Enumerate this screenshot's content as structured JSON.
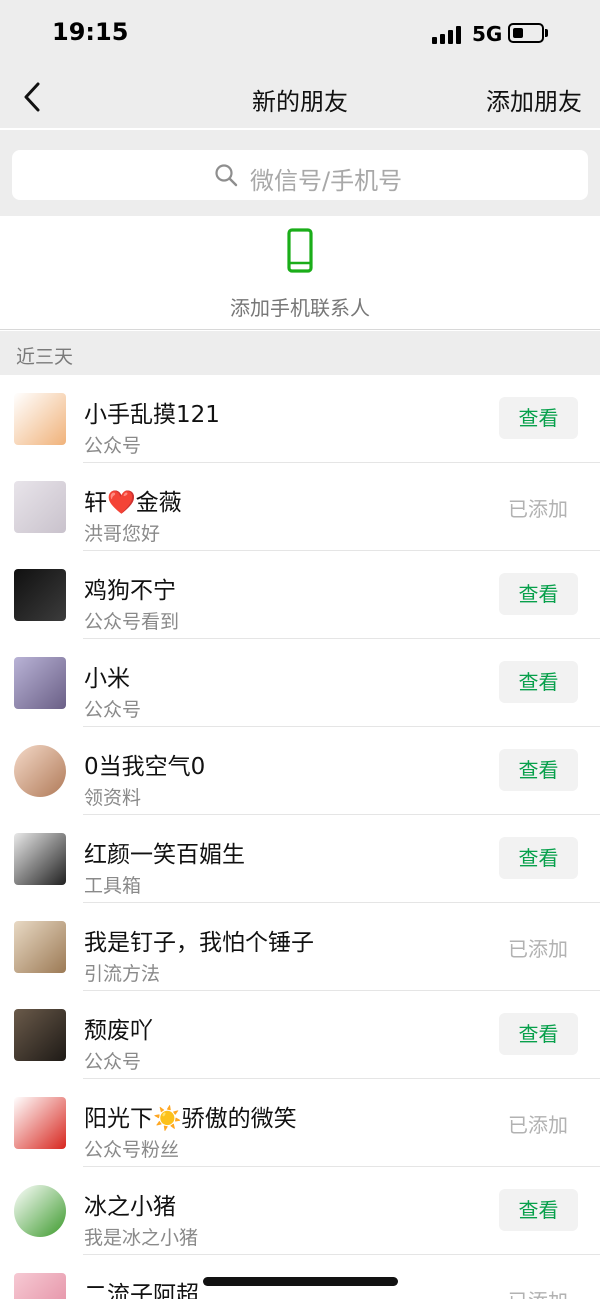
{
  "status_bar": {
    "time": "19:15",
    "network": "5G",
    "battery_level": 0.35
  },
  "nav": {
    "title": "新的朋友",
    "action": "添加朋友"
  },
  "search": {
    "placeholder": "微信号/手机号"
  },
  "add_contacts": {
    "label": "添加手机联系人"
  },
  "section": {
    "label": "近三天"
  },
  "labels": {
    "view": "查看",
    "added": "已添加"
  },
  "colors": {
    "accent_green": "#07a04b",
    "header_bg": "#ededed",
    "phone_icon": "#1aad19"
  },
  "friends": [
    {
      "name": "小手乱摸121",
      "message": "公众号",
      "status": "view",
      "avatar_colors": [
        "#ffffff",
        "#f0b27a"
      ]
    },
    {
      "name": "轩❤️金薇",
      "message": "洪哥您好",
      "status": "added",
      "avatar_colors": [
        "#e8e4ea",
        "#c9c2cc"
      ]
    },
    {
      "name": "鸡狗不宁",
      "message": "公众号看到",
      "status": "view",
      "avatar_colors": [
        "#101010",
        "#3c3c3c"
      ]
    },
    {
      "name": "小米",
      "message": "公众号",
      "status": "view",
      "avatar_colors": [
        "#b9b3d6",
        "#6a5f86"
      ]
    },
    {
      "name": "0当我空气0",
      "message": "领资料",
      "status": "view",
      "avatar_colors": [
        "#f4d9c8",
        "#b07a58"
      ]
    },
    {
      "name": "红颜一笑百媚生",
      "message": "工具箱",
      "status": "view",
      "avatar_colors": [
        "#e9e9e9",
        "#202020"
      ]
    },
    {
      "name": "我是钉子，我怕个锤子",
      "message": "引流方法",
      "status": "added",
      "avatar_colors": [
        "#e8d9c4",
        "#9c7a55"
      ]
    },
    {
      "name": "颓废吖",
      "message": "公众号",
      "status": "view",
      "avatar_colors": [
        "#6a5a4a",
        "#1e1a16"
      ]
    },
    {
      "name": "阳光下☀️骄傲的微笑",
      "message": "公众号粉丝",
      "status": "added",
      "avatar_colors": [
        "#ffffff",
        "#d7261e"
      ]
    },
    {
      "name": "冰之小猪",
      "message": "我是冰之小猪",
      "status": "view",
      "avatar_colors": [
        "#ffffff",
        "#3c9a2c"
      ]
    },
    {
      "name": "二流子阿超",
      "message": "",
      "status": "added",
      "avatar_colors": [
        "#f6c9d3",
        "#e28aa0"
      ]
    }
  ]
}
